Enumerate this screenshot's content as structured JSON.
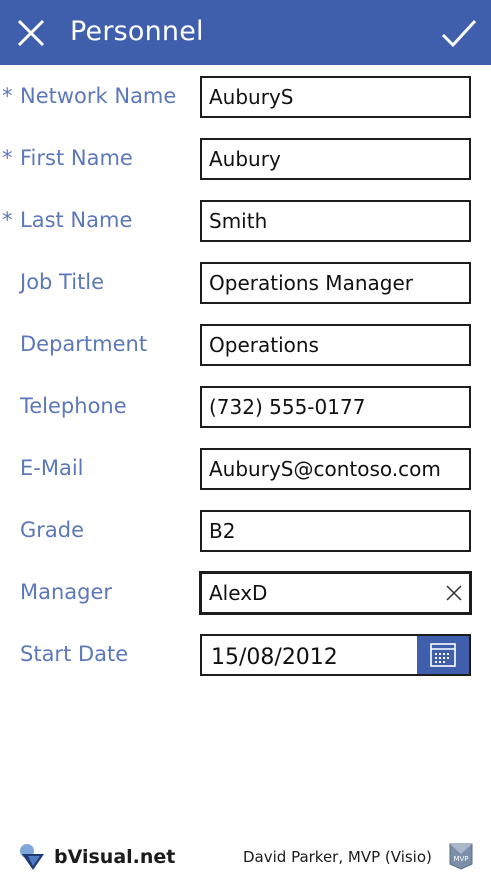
{
  "header": {
    "title": "Personnel"
  },
  "form": {
    "fields": [
      {
        "label": "Network Name",
        "required_mark": "*",
        "value": "AuburyS"
      },
      {
        "label": "First Name",
        "required_mark": "*",
        "value": "Aubury"
      },
      {
        "label": "Last Name",
        "required_mark": "*",
        "value": "Smith"
      },
      {
        "label": "Job Title",
        "value": "Operations Manager"
      },
      {
        "label": "Department",
        "value": "Operations"
      },
      {
        "label": "Telephone",
        "value": "(732) 555-0177"
      },
      {
        "label": "E-Mail",
        "value": "AuburyS@contoso.com"
      },
      {
        "label": "Grade",
        "value": "B2"
      },
      {
        "label": "Manager",
        "value": "AlexD"
      },
      {
        "label": "Start Date",
        "value": "15/08/2012"
      }
    ]
  },
  "footer": {
    "brand": "bVisual.net",
    "author": "David Parker, MVP (Visio)",
    "badge_text": "MVP"
  },
  "colors": {
    "accent": "#3f5fad",
    "label": "#5d78b9"
  },
  "icons": {
    "close": "close-icon",
    "confirm": "checkmark-icon",
    "clear": "clear-icon",
    "calendar": "calendar-icon"
  }
}
